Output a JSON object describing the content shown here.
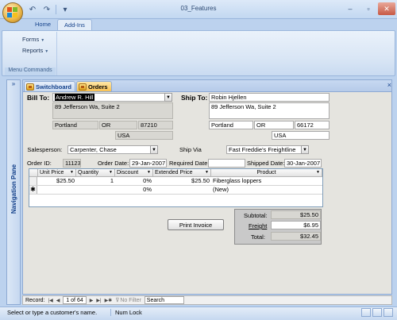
{
  "app": {
    "title": "03_Features",
    "quick_access": {
      "undo": "↶",
      "redo": "↷",
      "customize": "▾"
    },
    "window_controls": {
      "minimize": "–",
      "maximize": "▫",
      "close": "✕"
    }
  },
  "ribbon": {
    "tabs": [
      "Home",
      "Add-Ins"
    ],
    "active_tab": "Add-Ins",
    "menu_commands": {
      "forms": "Forms",
      "reports": "Reports",
      "group_label": "Menu Commands"
    }
  },
  "nav_pane": {
    "expand": "»",
    "label": "Navigation Pane"
  },
  "doc_tabs": {
    "items": [
      "Switchboard",
      "Orders"
    ],
    "active": "Orders",
    "close": "×"
  },
  "form": {
    "bill_to": {
      "label": "Bill To:",
      "name": "Andrew R. Hill",
      "address": "89 Jefferson Wa, Suite 2",
      "city": "Portland",
      "state": "OR",
      "zip": "87210",
      "country": "USA"
    },
    "ship_to": {
      "label": "Ship To:",
      "name": "Robin Hjellen",
      "address": "89 Jefferson Wa, Suite 2",
      "city": "Portland",
      "state": "OR",
      "zip": "66172",
      "country": "USA"
    },
    "salesperson": {
      "label": "Salesperson:",
      "value": "Carpenter, Chase"
    },
    "ship_via": {
      "label": "Ship Via",
      "value": "Fast Freddie's Freightline"
    },
    "order_id": {
      "label": "Order ID:",
      "value": "11123"
    },
    "order_date": {
      "label": "Order Date:",
      "value": "29-Jan-2007"
    },
    "required_date": {
      "label": "Required Date:",
      "value": ""
    },
    "shipped_date": {
      "label": "Shipped Date:",
      "value": "30-Jan-2007"
    },
    "details": {
      "columns": [
        "Unit Price",
        "Quantity",
        "Discount",
        "Extended Price",
        "Product"
      ],
      "rows": [
        {
          "unit_price": "$25.50",
          "quantity": "1",
          "discount": "0%",
          "extended_price": "$25.50",
          "product": "Fiberglass loppers"
        },
        {
          "unit_price": "",
          "quantity": "",
          "discount": "0%",
          "extended_price": "",
          "product": "(New)"
        }
      ],
      "new_row_marker": "✱"
    },
    "print_invoice": "Print Invoice",
    "totals": {
      "subtotal_label": "Subtotal:",
      "subtotal": "$25.50",
      "freight_label": "Freight",
      "freight": "$6.95",
      "total_label": "Total:",
      "total": "$32.45"
    }
  },
  "record_nav": {
    "label": "Record:",
    "first": "|◀",
    "prev": "◀",
    "position": "1 of 64",
    "next": "▶",
    "last": "▶|",
    "new": "▶✱",
    "filter": "No Filter",
    "search": "Search"
  },
  "status_bar": {
    "message": "Select or type a customer's name.",
    "num_lock": "Num Lock"
  }
}
